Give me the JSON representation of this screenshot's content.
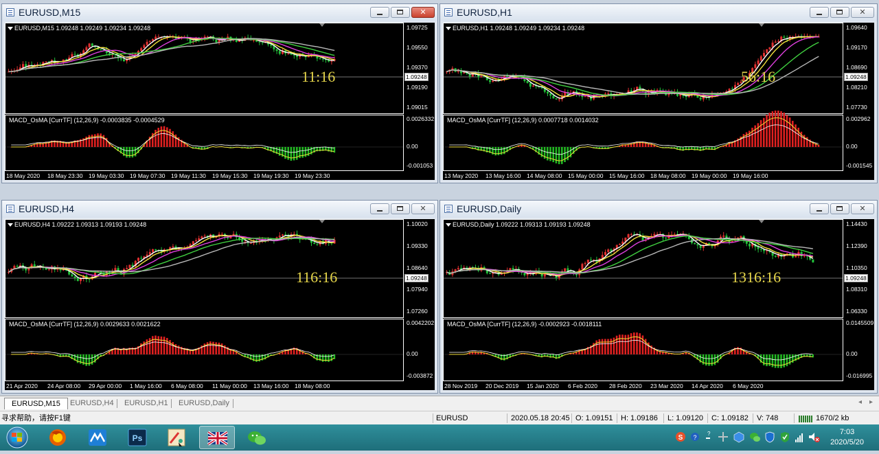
{
  "charts": [
    {
      "title": "EURUSD,M15",
      "info": "EURUSD,M15  1.09248 1.09249 1.09234 1.09248",
      "macd_label": "MACD_OsMA [CurrTF] (12,26,9) -0.0003835 -0.0004529",
      "price_ticks": [
        "1.09725",
        "1.09550",
        "1.09370",
        "1.09190",
        "1.09015"
      ],
      "current_price": "1.09248",
      "macd_ticks": [
        "0.0026332",
        "0.00",
        "-0.001053"
      ],
      "time_ticks": [
        "18 May 2020",
        "18 May 23:30",
        "19 May 03:30",
        "19 May 07:30",
        "19 May 11:30",
        "19 May 15:30",
        "19 May 19:30",
        "19 May 23:30"
      ],
      "timer": "11:16",
      "active_close": true
    },
    {
      "title": "EURUSD,H1",
      "info": "EURUSD,H1  1.09248 1.09249 1.09234 1.09248",
      "macd_label": "MACD_OsMA [CurrTF] (12,26,9) 0.0007718 0.0014032",
      "price_ticks": [
        "1.09640",
        "1.09170",
        "1.08690",
        "1.08210",
        "1.07730"
      ],
      "current_price": "1.09248",
      "macd_ticks": [
        "0.002962",
        "0.00",
        "-0.001545"
      ],
      "time_ticks": [
        "13 May 2020",
        "13 May 16:00",
        "14 May 08:00",
        "15 May 00:00",
        "15 May 16:00",
        "18 May 08:00",
        "19 May 00:00",
        "19 May 16:00"
      ],
      "timer": "56:16",
      "active_close": false
    },
    {
      "title": "EURUSD,H4",
      "info": "EURUSD,H4  1.09222 1.09313 1.09193 1.09248",
      "macd_label": "MACD_OsMA [CurrTF] (12,26,9) 0.0029633 0.0021622",
      "price_ticks": [
        "1.10020",
        "1.09330",
        "1.08640",
        "1.07940",
        "1.07260"
      ],
      "current_price": "1.09248",
      "macd_ticks": [
        "0.0042202",
        "0.00",
        "-0.003872"
      ],
      "time_ticks": [
        "21 Apr 2020",
        "24 Apr 08:00",
        "29 Apr 00:00",
        "1 May 16:00",
        "6 May 08:00",
        "11 May 00:00",
        "13 May 16:00",
        "18 May 08:00"
      ],
      "timer": "116:16",
      "active_close": false
    },
    {
      "title": "EURUSD,Daily",
      "info": "EURUSD,Daily  1.09222 1.09313 1.09193 1.09248",
      "macd_label": "MACD_OsMA [CurrTF] (12,26,9) -0.0002923 -0.0018111",
      "price_ticks": [
        "1.14430",
        "1.12390",
        "1.10350",
        "1.08310",
        "1.06330"
      ],
      "current_price": "1.09248",
      "macd_ticks": [
        "0.0145509",
        "0.00",
        "-0.016995"
      ],
      "time_ticks": [
        "28 Nov 2019",
        "20 Dec 2019",
        "15 Jan 2020",
        "6 Feb 2020",
        "28 Feb 2020",
        "23 Mar 2020",
        "14 Apr 2020",
        "6 May 2020"
      ],
      "timer": "1316:16",
      "active_close": false
    }
  ],
  "tabs": [
    "EURUSD,M15",
    "EURUSD,H4",
    "EURUSD,H1",
    "EURUSD,Daily"
  ],
  "status": {
    "help": "寻求帮助，请按F1键",
    "symbol": "EURUSD",
    "datetime": "2020.05.18 20:45",
    "open": "O: 1.09151",
    "high": "H: 1.09186",
    "low": "L: 1.09120",
    "close": "C: 1.09182",
    "volume": "V: 748",
    "traffic": "1670/2 kb"
  },
  "taskbar": {
    "time": "7:03",
    "date": "2020/5/20",
    "apps": [
      "start-orb",
      "firefox",
      "meitu",
      "photoshop",
      "paint",
      "mt4-uk-flag",
      "wechat"
    ]
  },
  "colors": {
    "chart_bg": "#000000",
    "bull_hist": "#e02020",
    "bear_hist": "#22b822",
    "ma_fast": "#ffffff",
    "ma_mid": "#f2e03a",
    "ma_slow": "#e040e0",
    "ma_long1": "#40d040",
    "ma_long2": "#b8b8b8",
    "timer": "#e5d54a"
  }
}
